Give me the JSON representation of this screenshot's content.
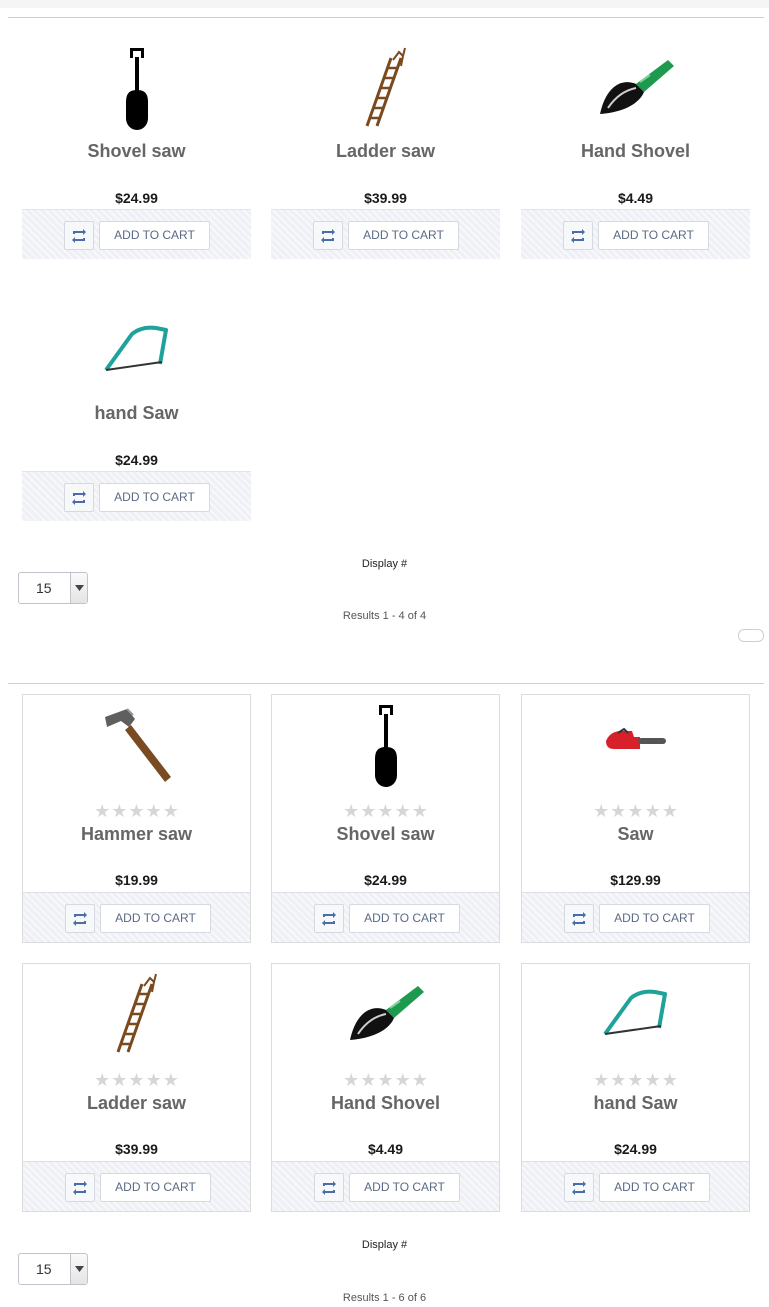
{
  "colors": {
    "price": "#1a1a1a",
    "title": "#666666",
    "button_text": "#5a6a84",
    "action_bg": "#eef0f5"
  },
  "section1": {
    "products": [
      {
        "name": "Shovel saw",
        "price": "$24.99",
        "image": "shovel-icon",
        "cart_label": "ADD TO CART"
      },
      {
        "name": "Ladder saw",
        "price": "$39.99",
        "image": "ladder-icon",
        "cart_label": "ADD TO CART"
      },
      {
        "name": "Hand Shovel",
        "price": "$4.49",
        "image": "trowel-icon",
        "cart_label": "ADD TO CART"
      },
      {
        "name": "hand Saw",
        "price": "$24.99",
        "image": "hacksaw-icon",
        "cart_label": "ADD TO CART"
      }
    ],
    "display_label": "Display #",
    "display_value": "15",
    "results": "Results 1 - 4 of 4"
  },
  "section2": {
    "products": [
      {
        "name": "Hammer saw",
        "price": "$19.99",
        "image": "hammer-icon",
        "cart_label": "ADD TO CART",
        "rating": 0
      },
      {
        "name": "Shovel saw",
        "price": "$24.99",
        "image": "shovel-icon",
        "cart_label": "ADD TO CART",
        "rating": 0
      },
      {
        "name": "Saw",
        "price": "$129.99",
        "image": "chainsaw-icon",
        "cart_label": "ADD TO CART",
        "rating": 0
      },
      {
        "name": "Ladder saw",
        "price": "$39.99",
        "image": "ladder-icon",
        "cart_label": "ADD TO CART",
        "rating": 0
      },
      {
        "name": "Hand Shovel",
        "price": "$4.49",
        "image": "trowel-icon",
        "cart_label": "ADD TO CART",
        "rating": 0
      },
      {
        "name": "hand Saw",
        "price": "$24.99",
        "image": "hacksaw-icon",
        "cart_label": "ADD TO CART",
        "rating": 0
      }
    ],
    "display_label": "Display #",
    "display_value": "15",
    "results": "Results 1 - 6 of 6"
  }
}
